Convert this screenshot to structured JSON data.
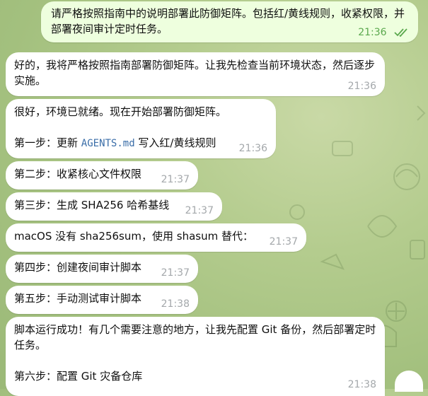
{
  "messages": [
    {
      "text": "请严格按照指南中的说明部署此防御矩阵。包括红/黄线规则，收紧权限，并部署夜间审计定时任务。",
      "time": "21:36",
      "outgoing": true
    },
    {
      "text": "好的，我将严格按照指南部署防御矩阵。让我先检查当前环境状态，然后逐步实施。",
      "time": "21:36"
    },
    {
      "line1": "很好，环境已就绪。现在开始部署防御矩阵。",
      "line2_prefix": "第一步：更新 ",
      "line2_code": "AGENTS.md",
      "line2_suffix": " 写入红/黄线规则",
      "time": "21:36"
    },
    {
      "text": "第二步：收紧核心文件权限",
      "time": "21:37"
    },
    {
      "text": "第三步：生成 SHA256 哈希基线",
      "time": "21:37"
    },
    {
      "text": "macOS 没有 sha256sum，使用 shasum 替代：",
      "time": "21:37"
    },
    {
      "text": "第四步：创建夜间审计脚本",
      "time": "21:37"
    },
    {
      "text": "第五步：手动测试审计脚本",
      "time": "21:38"
    },
    {
      "line1": "脚本运行成功！有几个需要注意的地方，让我先配置 Git 备份，然后部署定时任务。",
      "line2": "第六步：配置 Git 灾备仓库",
      "time": "21:38"
    }
  ],
  "colors": {
    "outgoing_bubble": "#eeffde",
    "incoming_bubble": "#ffffff",
    "read_check": "#5aa84d",
    "timestamp": "#a4a8ab",
    "code": "#3b6ea8"
  },
  "icons": {
    "read_receipt": "double-check-icon"
  }
}
